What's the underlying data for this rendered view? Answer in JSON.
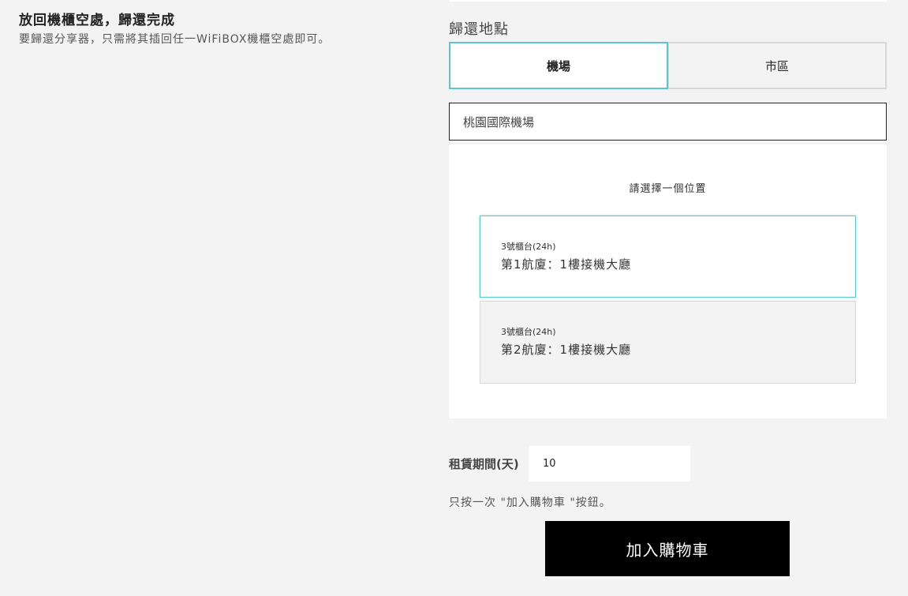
{
  "info": {
    "title": "放回機櫃空處，歸還完成",
    "description": "要歸還分享器，只需將其插回任一WiFiBOX機櫃空處即可。"
  },
  "return_location": {
    "label": "歸還地點",
    "tabs": [
      {
        "label": "機場",
        "active": true
      },
      {
        "label": "市區",
        "active": false
      }
    ],
    "selected_place": "桃園國際機場",
    "hint": "請選擇一個位置",
    "locations": [
      {
        "counter": "3號櫃台(24h)",
        "name": "第1航廈：1樓接機大廳",
        "selected": true
      },
      {
        "counter": "3號櫃台(24h)",
        "name": "第2航廈：1樓接機大廳",
        "selected": false
      }
    ]
  },
  "rental": {
    "label": "租賃期間(天)",
    "value": "10"
  },
  "note": "只按一次 \"加入購物車 \"按鈕。",
  "cart_button": "加入購物車",
  "colors": {
    "accent": "#5bc6cd",
    "background": "#f3f3f3",
    "button": "#000000"
  }
}
